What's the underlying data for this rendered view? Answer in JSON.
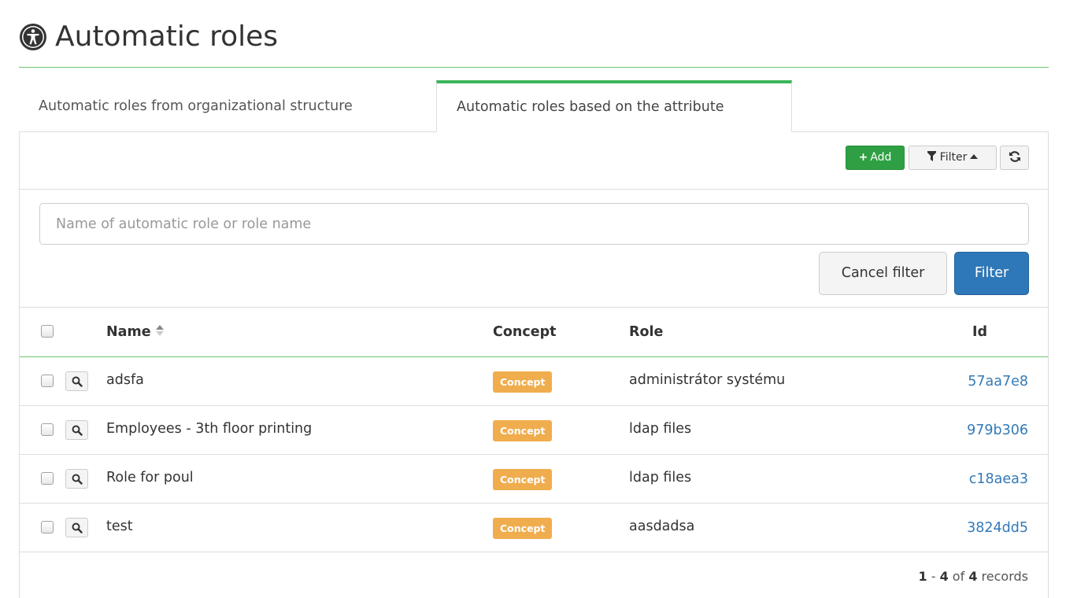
{
  "header": {
    "title": "Automatic roles",
    "icon": "universal-access-icon"
  },
  "tabs": [
    {
      "label": "Automatic roles from organizational structure",
      "active": false
    },
    {
      "label": "Automatic roles based on the attribute",
      "active": true
    }
  ],
  "toolbar": {
    "add_label": "Add",
    "filter_label": "Filter",
    "refresh_icon": "refresh-icon"
  },
  "filter": {
    "placeholder": "Name of automatic role or role name",
    "value": "",
    "cancel_label": "Cancel filter",
    "apply_label": "Filter"
  },
  "table": {
    "columns": {
      "name": "Name",
      "concept": "Concept",
      "role": "Role",
      "id": "Id"
    },
    "rows": [
      {
        "name": "adsfa",
        "concept": "Concept",
        "role": "administrátor systému",
        "id": "57aa7e8"
      },
      {
        "name": "Employees - 3th floor printing",
        "concept": "Concept",
        "role": "ldap files",
        "id": "979b306"
      },
      {
        "name": "Role for poul",
        "concept": "Concept",
        "role": "ldap files",
        "id": "c18aea3"
      },
      {
        "name": "test",
        "concept": "Concept",
        "role": "aasdadsa",
        "id": "3824dd5"
      }
    ]
  },
  "pagination": {
    "from": "1",
    "to": "4",
    "total": "4",
    "of_label": "of",
    "records_label": "records"
  },
  "colors": {
    "accent_green": "#3cb55a",
    "add_green": "#2ea043",
    "primary_blue": "#2e77b8",
    "badge_orange": "#f0ad4e",
    "link_blue": "#337ab7"
  }
}
